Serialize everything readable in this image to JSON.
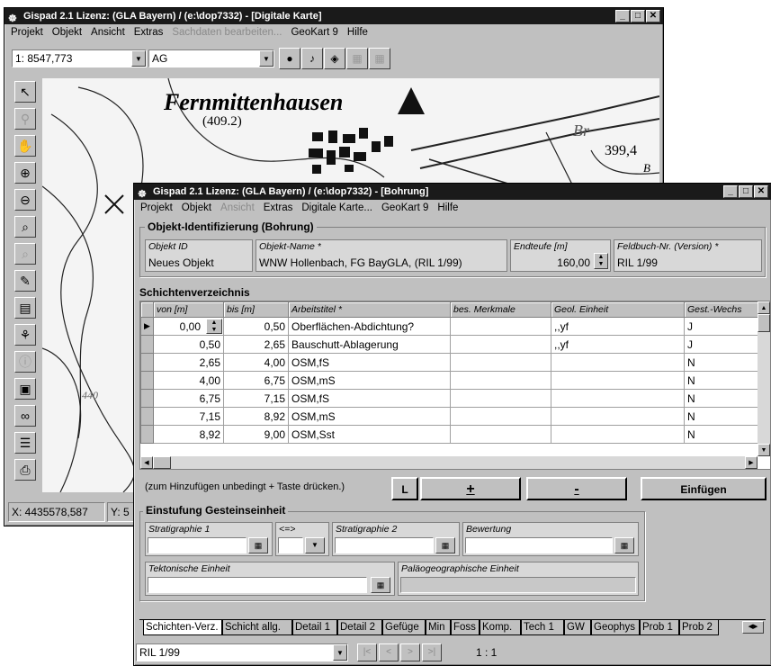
{
  "map_window": {
    "title": "Gispad 2.1 Lizenz: (GLA Bayern)  / (e:\\dop7332) - [Digitale Karte]",
    "menu": [
      "Projekt",
      "Objekt",
      "Ansicht",
      "Extras",
      "Sachdaten bearbeiten...",
      "GeoKart 9",
      "Hilfe"
    ],
    "scale_value": "1: 8547,773",
    "layer_value": "AG",
    "map_labels": {
      "town": "Fernmittenhausen",
      "town_height": "(409.2)",
      "height": "399,4",
      "partial_br": "Br",
      "partial_b": "B",
      "contour": "440"
    },
    "status_x": "X: 4435578,587",
    "status_y": "Y: 5"
  },
  "form_window": {
    "title": "Gispad 2.1 Lizenz: (GLA Bayern)  / (e:\\dop7332) - [Bohrung]",
    "menu": [
      "Projekt",
      "Objekt",
      "Ansicht",
      "Extras",
      "Digitale Karte...",
      "GeoKart 9",
      "Hilfe"
    ],
    "ident_group": "Objekt-Identifizierung  (Bohrung)",
    "fields": {
      "objekt_id_label": "Objekt ID",
      "objekt_id_value": "Neues Objekt",
      "objekt_name_label": "Objekt-Name *",
      "objekt_name_value": "WNW Hollenbach, FG BayGLA, (RIL 1/99)",
      "endteufe_label": "Endteufe [m]",
      "endteufe_value": "160,00",
      "feldbuch_label": "Feldbuch-Nr. (Version) *",
      "feldbuch_value": "RIL 1/99"
    },
    "schichten_title": "Schichtenverzeichnis",
    "table": {
      "headers": [
        "von [m]",
        "bis [m]",
        "Arbeitstitel *",
        "bes. Merkmale",
        "Geol. Einheit",
        "Gest.-Wechs"
      ],
      "rows": [
        [
          "0,00",
          "0,50",
          "Oberflächen-Abdichtung?",
          "",
          ",,yf",
          "J"
        ],
        [
          "0,50",
          "2,65",
          "Bauschutt-Ablagerung",
          "",
          ",,yf",
          "J"
        ],
        [
          "2,65",
          "4,00",
          "OSM,fS",
          "",
          "",
          "N"
        ],
        [
          "4,00",
          "6,75",
          "OSM,mS",
          "",
          "",
          "N"
        ],
        [
          "6,75",
          "7,15",
          "OSM,fS",
          "",
          "",
          "N"
        ],
        [
          "7,15",
          "8,92",
          "OSM,mS",
          "",
          "",
          "N"
        ],
        [
          "8,92",
          "9,00",
          "OSM,Sst",
          "",
          "",
          "N"
        ]
      ]
    },
    "hint": "(zum Hinzufügen unbedingt + Taste drücken.)",
    "buttons": {
      "l": "L",
      "plus": "+",
      "minus": "-",
      "einfuegen": "Einfügen"
    },
    "einstufung_title": "Einstufung Gesteinseinheit",
    "strat1_label": "Stratigraphie 1",
    "op_label": "<=>",
    "strat2_label": "Stratigraphie 2",
    "bewertung_label": "Bewertung",
    "tekto_label": "Tektonische Einheit",
    "palaeo_label": "Paläogeographische Einheit",
    "tabs": [
      "Schichten-Verz.",
      "Schicht allg.",
      "Detail 1",
      "Detail 2",
      "Gefüge",
      "Min",
      "Foss",
      "Komp.",
      "Tech 1",
      "GW",
      "Geophys",
      "Prob 1",
      "Prob 2"
    ],
    "nav_value": "RIL 1/99",
    "nav_buttons": [
      "|<",
      "<",
      ">",
      ">|"
    ],
    "record_count": "1 : 1"
  }
}
